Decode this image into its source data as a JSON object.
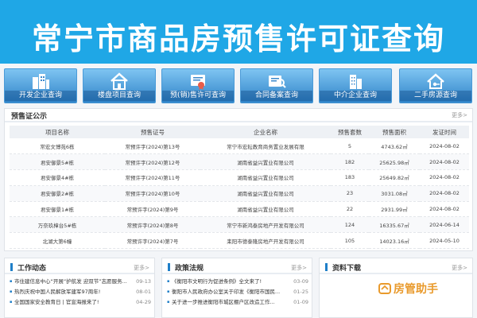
{
  "banner": {
    "title": "常宁市商品房预售许可证查询"
  },
  "nav": {
    "items": [
      {
        "label": "开发企业查询",
        "icon": "buildings-icon"
      },
      {
        "label": "楼盘项目查询",
        "icon": "house-icon"
      },
      {
        "label": "预(销)售许可查询",
        "icon": "certificate-icon"
      },
      {
        "label": "合同备案查询",
        "icon": "contract-search-icon"
      },
      {
        "label": "中介企业查询",
        "icon": "office-building-icon"
      },
      {
        "label": "二手房源查询",
        "icon": "home-key-icon"
      }
    ]
  },
  "presale": {
    "title": "预售证公示",
    "more": "更多>",
    "columns": [
      "项目名称",
      "预售证号",
      "企业名称",
      "预售套数",
      "预售面积",
      "发证时间"
    ],
    "rows": [
      [
        "常宏文博苑6栋",
        "常预许字(2024)第13号",
        "常宁市宏耘教育商务置业发展有限",
        "5",
        "4743.62㎡",
        "2024-08-02"
      ],
      [
        "君安御景5#栋",
        "常预许字(2024)第12号",
        "湖南省益兴置业有限公司",
        "182",
        "25625.98㎡",
        "2024-08-02"
      ],
      [
        "君安御景4#栋",
        "常预许字(2024)第11号",
        "湖南省益兴置业有限公司",
        "183",
        "25649.82㎡",
        "2024-08-02"
      ],
      [
        "君安御景2#栋",
        "常预许字(2024)第10号",
        "湖南省益兴置业有限公司",
        "23",
        "3031.08㎡",
        "2024-08-02"
      ],
      [
        "君安御景1#栋",
        "常预许字(2024)第9号",
        "湖南省益兴置业有限公司",
        "22",
        "2931.99㎡",
        "2024-08-02"
      ],
      [
        "万奈玖樟台5#栋",
        "常预许字(2024)第8号",
        "常宁市新鸿泰房地产开发有限公司",
        "124",
        "16335.67㎡",
        "2024-06-14"
      ],
      [
        "北湖大第6幢",
        "常预许字(2024)第7号",
        "耒阳市德泰隆房地产开发有限公司",
        "105",
        "14023.16㎡",
        "2024-05-10"
      ]
    ]
  },
  "news": {
    "title": "工作动态",
    "more": "更多>",
    "items": [
      {
        "text": "市住建信息中心“开展“护航发 迎双节”志愿服务...",
        "date": "09-13"
      },
      {
        "text": "热烈庆祝中国人民解放军建军97周年!",
        "date": "08-01"
      },
      {
        "text": "全国国家安全教育日 | 官宣海报来了!",
        "date": "04-29"
      }
    ]
  },
  "policy": {
    "title": "政策法规",
    "more": "更多>",
    "items": [
      {
        "text": "《衡阳市文明行为促进条例》全文来了!",
        "date": "03-09"
      },
      {
        "text": "衡阳市人民政府办公室关于印发《衡阳市国民...",
        "date": "01-25"
      },
      {
        "text": "关于进一步推进衡阳市城区棚户区改造工作...",
        "date": "01-09"
      }
    ]
  },
  "downloads": {
    "title": "资料下载",
    "more": "更多>",
    "logo_text": "房管助手",
    "logo_icon": "house-helper-icon",
    "logo_color": "#e99a2c"
  }
}
